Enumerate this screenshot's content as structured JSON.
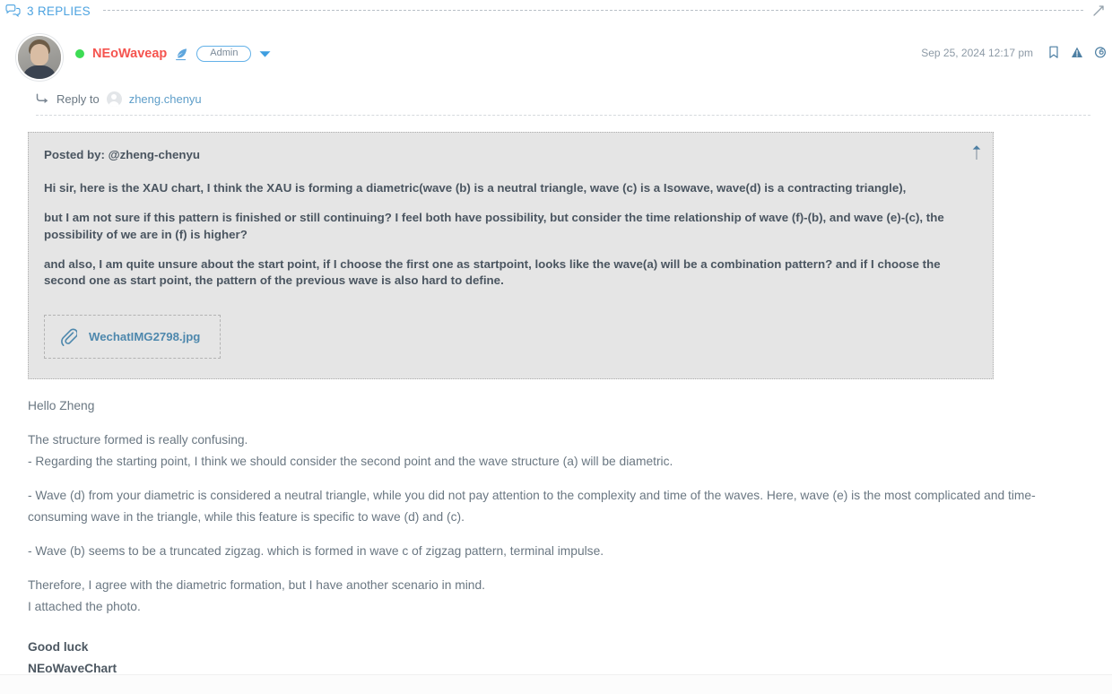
{
  "replies_bar": {
    "label": "3 REPLIES",
    "icon": "comments-icon",
    "expand_icon": "expand-diagonal-icon"
  },
  "post": {
    "author": {
      "name": "NEoWaveap",
      "status": "online",
      "status_color": "#3ddc54",
      "name_color": "#f5544f",
      "quill_icon": "quill-pen-icon",
      "badge": "Admin",
      "dropdown_icon": "chevron-down-icon",
      "avatar": "user-avatar"
    },
    "timestamp": "Sep 25, 2024 12:17 pm",
    "actions": [
      {
        "name": "bookmark-icon"
      },
      {
        "name": "report-warning-icon"
      },
      {
        "name": "link-icon"
      }
    ],
    "reply_to": {
      "prefix": "Reply to",
      "user": "zheng.chenyu",
      "arrow_icon": "reply-arrow-icon",
      "avatar_icon": "user-placeholder-avatar"
    }
  },
  "quote": {
    "author_line": "Posted by: @zheng-chenyu",
    "collapse_icon": "arrow-up-icon",
    "paragraphs": [
      "Hi sir, here is the XAU chart, I think the XAU is forming a diametric(wave (b) is a neutral triangle, wave (c) is a Isowave, wave(d) is a contracting triangle),",
      "but I am not sure if this pattern is finished or still continuing? I feel both have possibility, but consider the time relationship of wave (f)-(b), and wave (e)-(c), the possibility of we are in (f) is higher?",
      "and also, I am quite unsure about the start point, if I choose the first one as startpoint, looks like the wave(a) will be a combination pattern? and if I choose the second one as start point, the pattern of the previous wave is also hard to define."
    ],
    "attachment": {
      "icon": "paperclip-icon",
      "filename": "WechatIMG2798.jpg"
    }
  },
  "reply_body": {
    "greeting": "Hello Zheng",
    "para1_line1": "The structure formed is really confusing.",
    "para1_line2": "- Regarding the starting point, I think we should consider the second point and the wave structure (a) will be diametric.",
    "para2": "- Wave (d) from your diametric is considered a neutral triangle, while you did not pay attention to the complexity and time of the waves. Here, wave (e) is the most complicated and time-consuming wave in the triangle, while this feature is specific to wave (d) and (c).",
    "para3": "- Wave (b) seems to be a truncated zigzag. which is formed in wave c of zigzag pattern, terminal impulse.",
    "para4_line1": "Therefore, I agree with the diametric formation, but I have another scenario in mind.",
    "para4_line2": "I attached the photo.",
    "signature_line1": "Good luck",
    "signature_line2": "NEoWaveChart"
  },
  "colors": {
    "accent_blue": "#4da3e0",
    "username_red": "#f5544f",
    "quote_bg": "#e5e5e5",
    "body_text": "#6a7782",
    "link_blue": "#5e9ec9"
  }
}
